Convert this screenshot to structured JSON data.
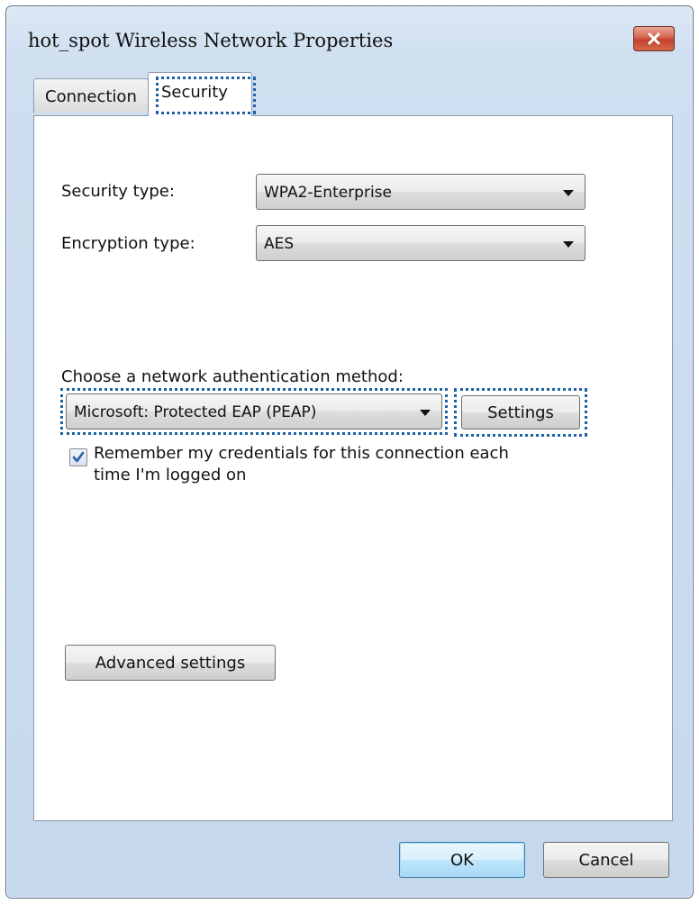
{
  "window": {
    "title": "hot_spot Wireless Network Properties"
  },
  "tabs": [
    {
      "label": "Connection",
      "selected": false
    },
    {
      "label": "Security",
      "selected": true
    }
  ],
  "security": {
    "security_type_label": "Security type:",
    "security_type_value": "WPA2-Enterprise",
    "encryption_type_label": "Encryption type:",
    "encryption_type_value": "AES",
    "auth_method_label": "Choose a network authentication method:",
    "auth_method_value": "Microsoft: Protected EAP (PEAP)",
    "settings_button": "Settings",
    "remember_checkbox": {
      "checked": true,
      "line1": "Remember my credentials for this connection each",
      "line2": "time I'm logged on"
    },
    "advanced_button": "Advanced settings"
  },
  "footer": {
    "ok_button": "OK",
    "cancel_button": "Cancel"
  },
  "icons": {
    "close": "close-icon",
    "dropdown": "chevron-down-icon",
    "check": "checkmark-icon"
  },
  "colors": {
    "focus_ring": "#1f5fa8",
    "close_button": "#c2412a",
    "check_mark": "#2c5fa3"
  }
}
